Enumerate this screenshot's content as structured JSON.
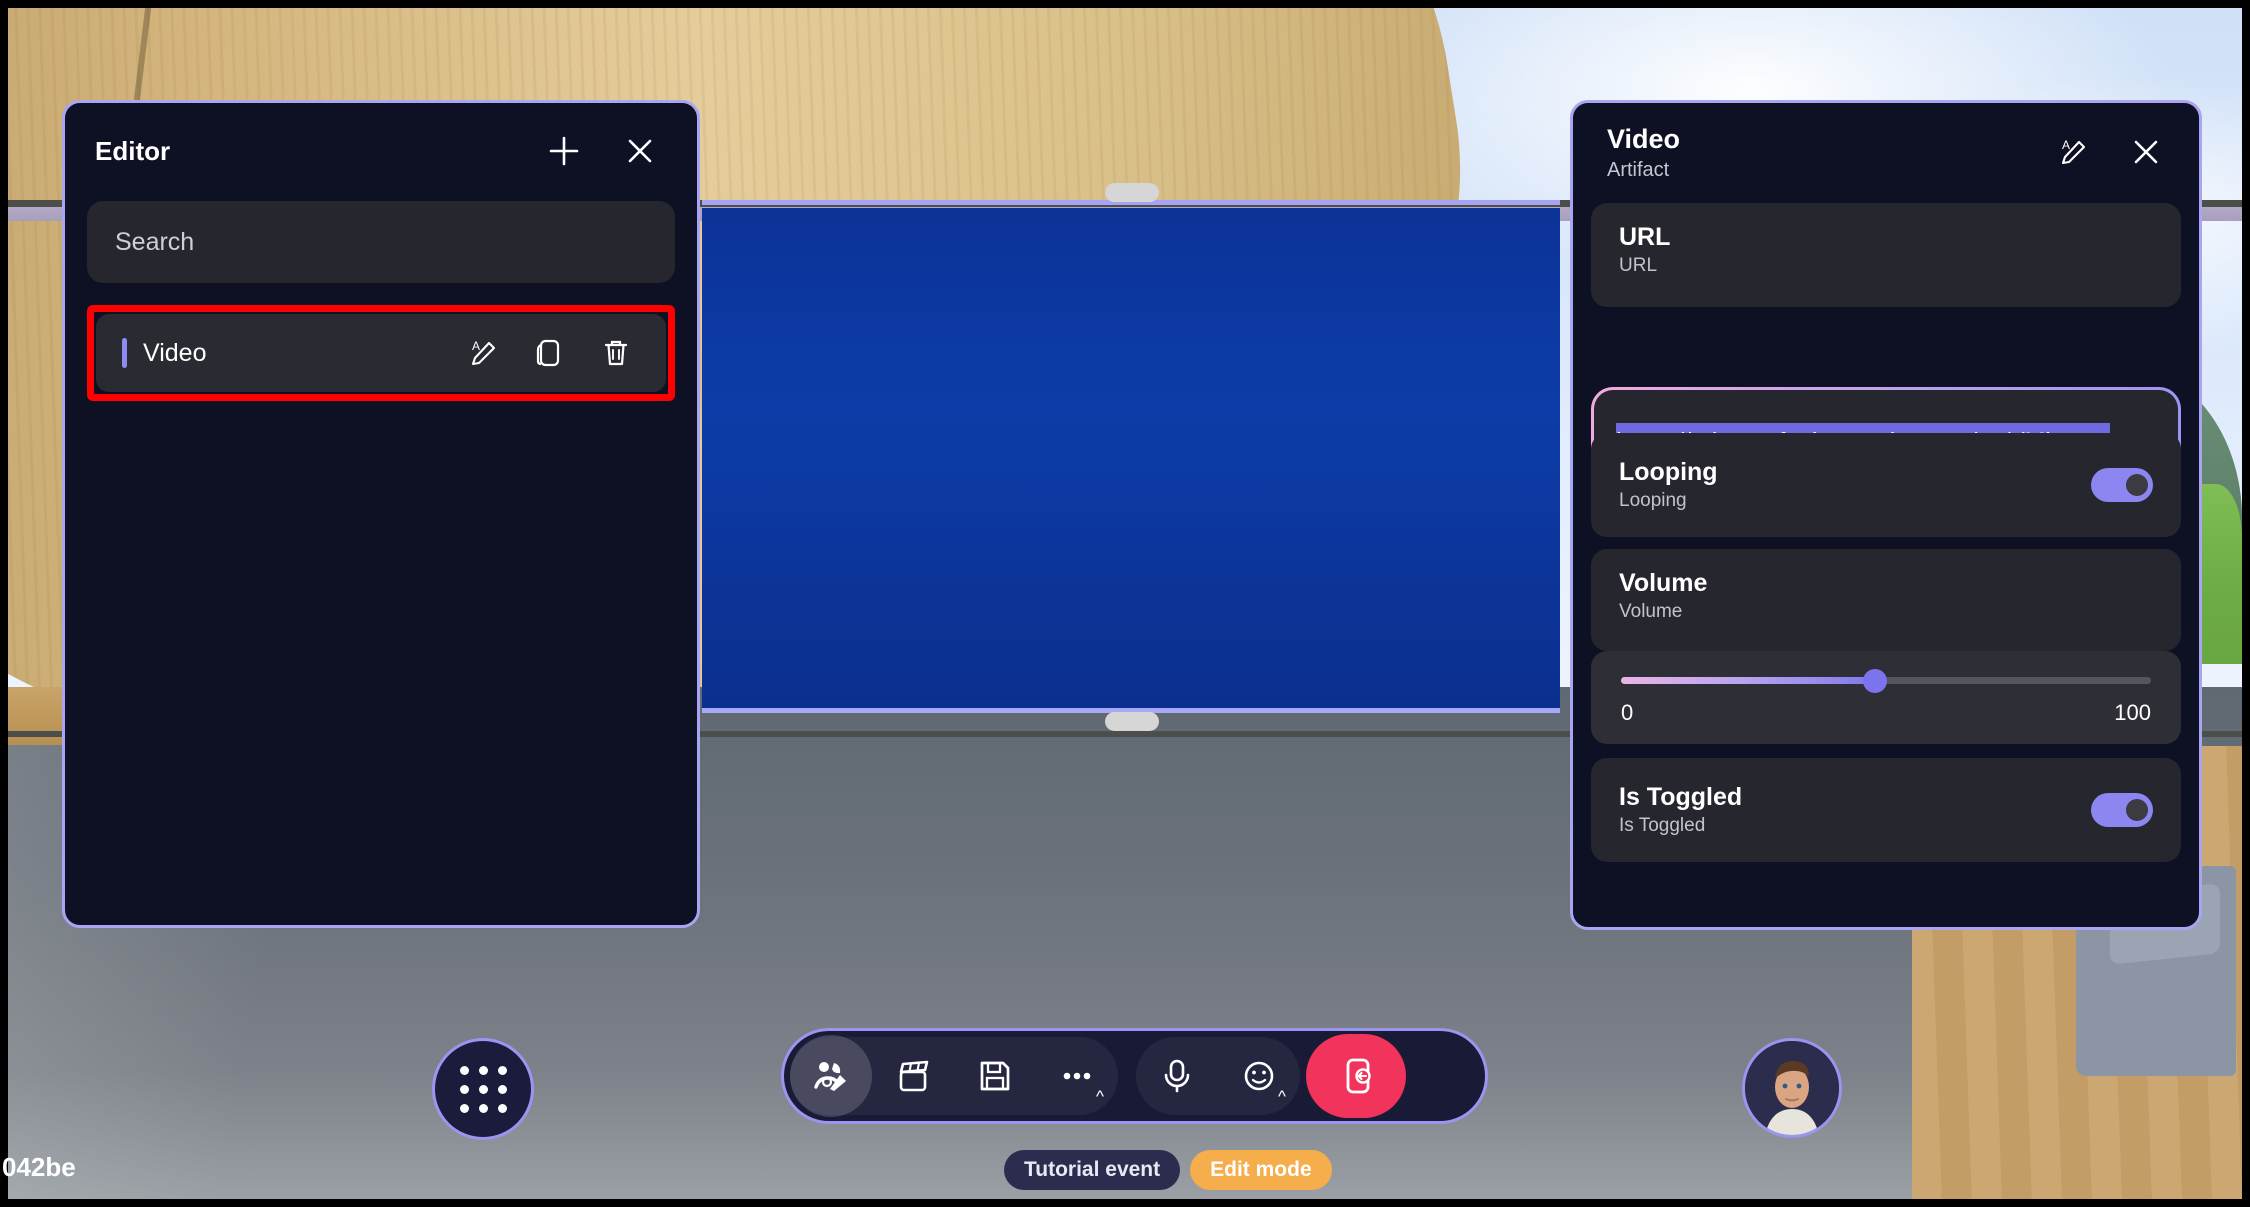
{
  "scene": {
    "corner_text": "042be"
  },
  "video_surface": {
    "handle_top": "drag-handle-top",
    "handle_bottom": "drag-handle-bottom",
    "placeholder_icon": "play-icon"
  },
  "editor_panel": {
    "title": "Editor",
    "add_icon": "plus-icon",
    "close_icon": "close-icon",
    "search": {
      "placeholder": "Search",
      "value": ""
    },
    "items": [
      {
        "label": "Video",
        "selected": true,
        "rename_icon": "rename-icon",
        "duplicate_icon": "duplicate-icon",
        "delete_icon": "trash-icon"
      }
    ]
  },
  "artifact_panel": {
    "title": "Video",
    "subtitle": "Artifact",
    "rename_icon": "rename-icon",
    "close_icon": "close-icon",
    "url_section": {
      "title": "URL",
      "subtitle": "URL",
      "value": "https://microsoft.sharepoint.com/:v:/t/Microsof",
      "clear_icon": "close-icon",
      "selected": true
    },
    "looping_section": {
      "title": "Looping",
      "subtitle": "Looping",
      "toggle_on": true
    },
    "volume_section": {
      "title": "Volume",
      "subtitle": "Volume",
      "min_label": "0",
      "max_label": "100",
      "value_percent": 48
    },
    "is_toggled_section": {
      "title": "Is Toggled",
      "subtitle": "Is Toggled",
      "toggle_on": true
    }
  },
  "toolbar": {
    "buttons": [
      {
        "name": "edit-tools-button",
        "icon": "people-edit-icon",
        "active": true
      },
      {
        "name": "record-button",
        "icon": "clapperboard-icon",
        "active": false
      },
      {
        "name": "save-button",
        "icon": "save-icon",
        "active": false
      },
      {
        "name": "more-button",
        "icon": "ellipsis-icon",
        "active": false,
        "caret": "^"
      },
      {
        "name": "mic-button",
        "icon": "microphone-icon",
        "active": false
      },
      {
        "name": "reactions-button",
        "icon": "emoji-icon",
        "active": false,
        "caret": "^"
      },
      {
        "name": "leave-button",
        "icon": "leave-icon",
        "active": false
      }
    ]
  },
  "app_launcher": {
    "icon": "grid-apps-icon"
  },
  "avatar": {
    "icon": "user-avatar"
  },
  "badges": {
    "event_label": "Tutorial event",
    "mode_label": "Edit mode"
  },
  "colors": {
    "panel_border": "#a9a5f2",
    "panel_bg": "#0e1024",
    "accent": "#8b86f0",
    "selection_highlight": "#ff0000",
    "leave_red": "#f2335c",
    "edit_mode_orange": "#f6ad4c",
    "text_selection": "#6f6ae0"
  }
}
